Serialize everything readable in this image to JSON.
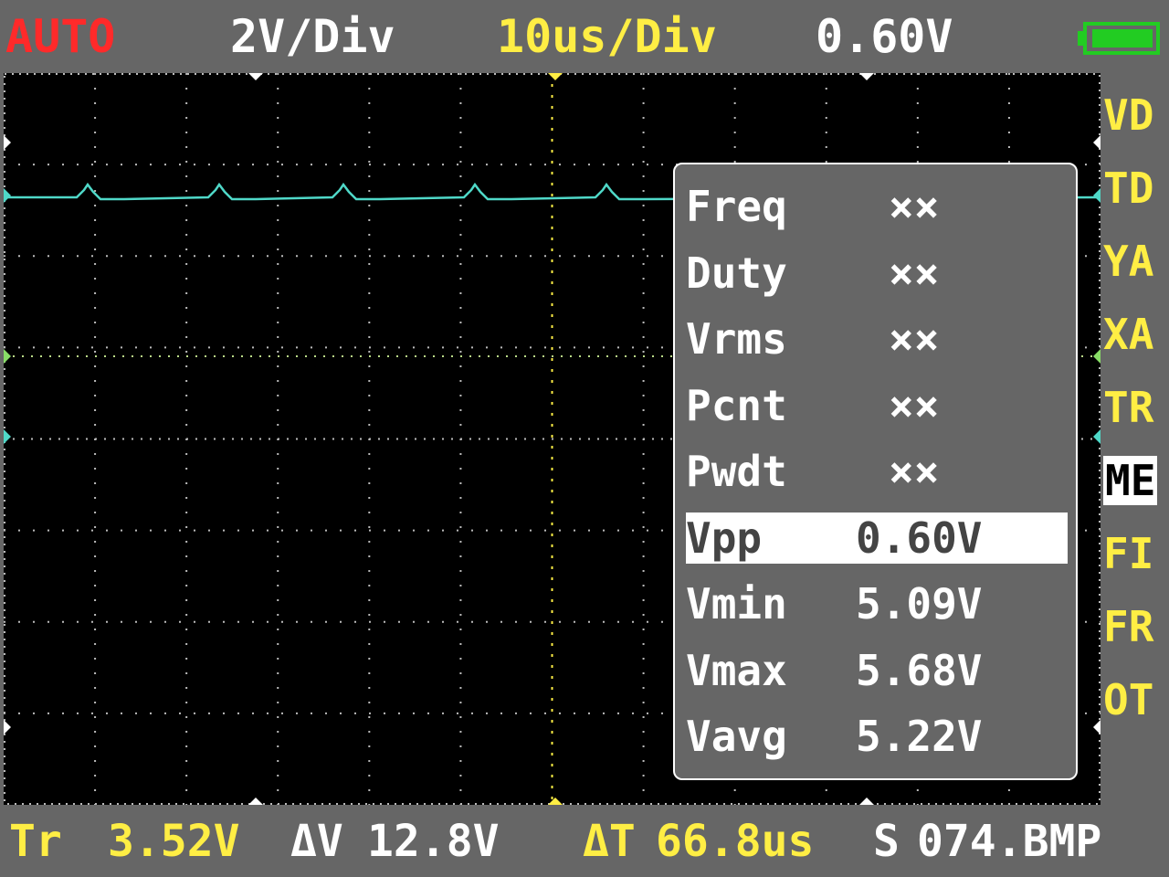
{
  "header": {
    "mode": "AUTO",
    "trigger_edge_icon": "rising-edge-icon",
    "volts_per_div": "2V/Div",
    "time_per_div": "10us/Div",
    "offset": "0.60V",
    "battery_icon": "battery-full-icon",
    "colors": {
      "mode": "#ff2a2a",
      "time": "#ffee44",
      "trace": "#4fd8c8",
      "battery": "#22cc22"
    }
  },
  "side_menu": [
    {
      "label": "VD",
      "selected": false
    },
    {
      "label": "TD",
      "selected": false
    },
    {
      "label": "YA",
      "selected": false
    },
    {
      "label": "XA",
      "selected": false
    },
    {
      "label": "TR",
      "selected": false
    },
    {
      "label": "ME",
      "selected": true
    },
    {
      "label": "FI",
      "selected": false
    },
    {
      "label": "FR",
      "selected": false
    },
    {
      "label": "OT",
      "selected": false
    }
  ],
  "measurements": [
    {
      "label": "Freq",
      "value": "××",
      "selected": false
    },
    {
      "label": "Duty",
      "value": "××",
      "selected": false
    },
    {
      "label": "Vrms",
      "value": "××",
      "selected": false
    },
    {
      "label": "Pcnt",
      "value": "××",
      "selected": false
    },
    {
      "label": "Pwdt",
      "value": "××",
      "selected": false
    },
    {
      "label": "Vpp",
      "value": "0.60V",
      "selected": true
    },
    {
      "label": "Vmin",
      "value": "5.09V",
      "selected": false
    },
    {
      "label": "Vmax",
      "value": "5.68V",
      "selected": false
    },
    {
      "label": "Vavg",
      "value": "5.22V",
      "selected": false
    }
  ],
  "footer": {
    "tr_label": "Tr",
    "tr_value": "3.52V",
    "dv_label": "ΔV",
    "dv_value": "12.8V",
    "dt_label": "ΔT",
    "dt_value": "66.8us",
    "file_label": "S",
    "file_value": "074.BMP"
  }
}
